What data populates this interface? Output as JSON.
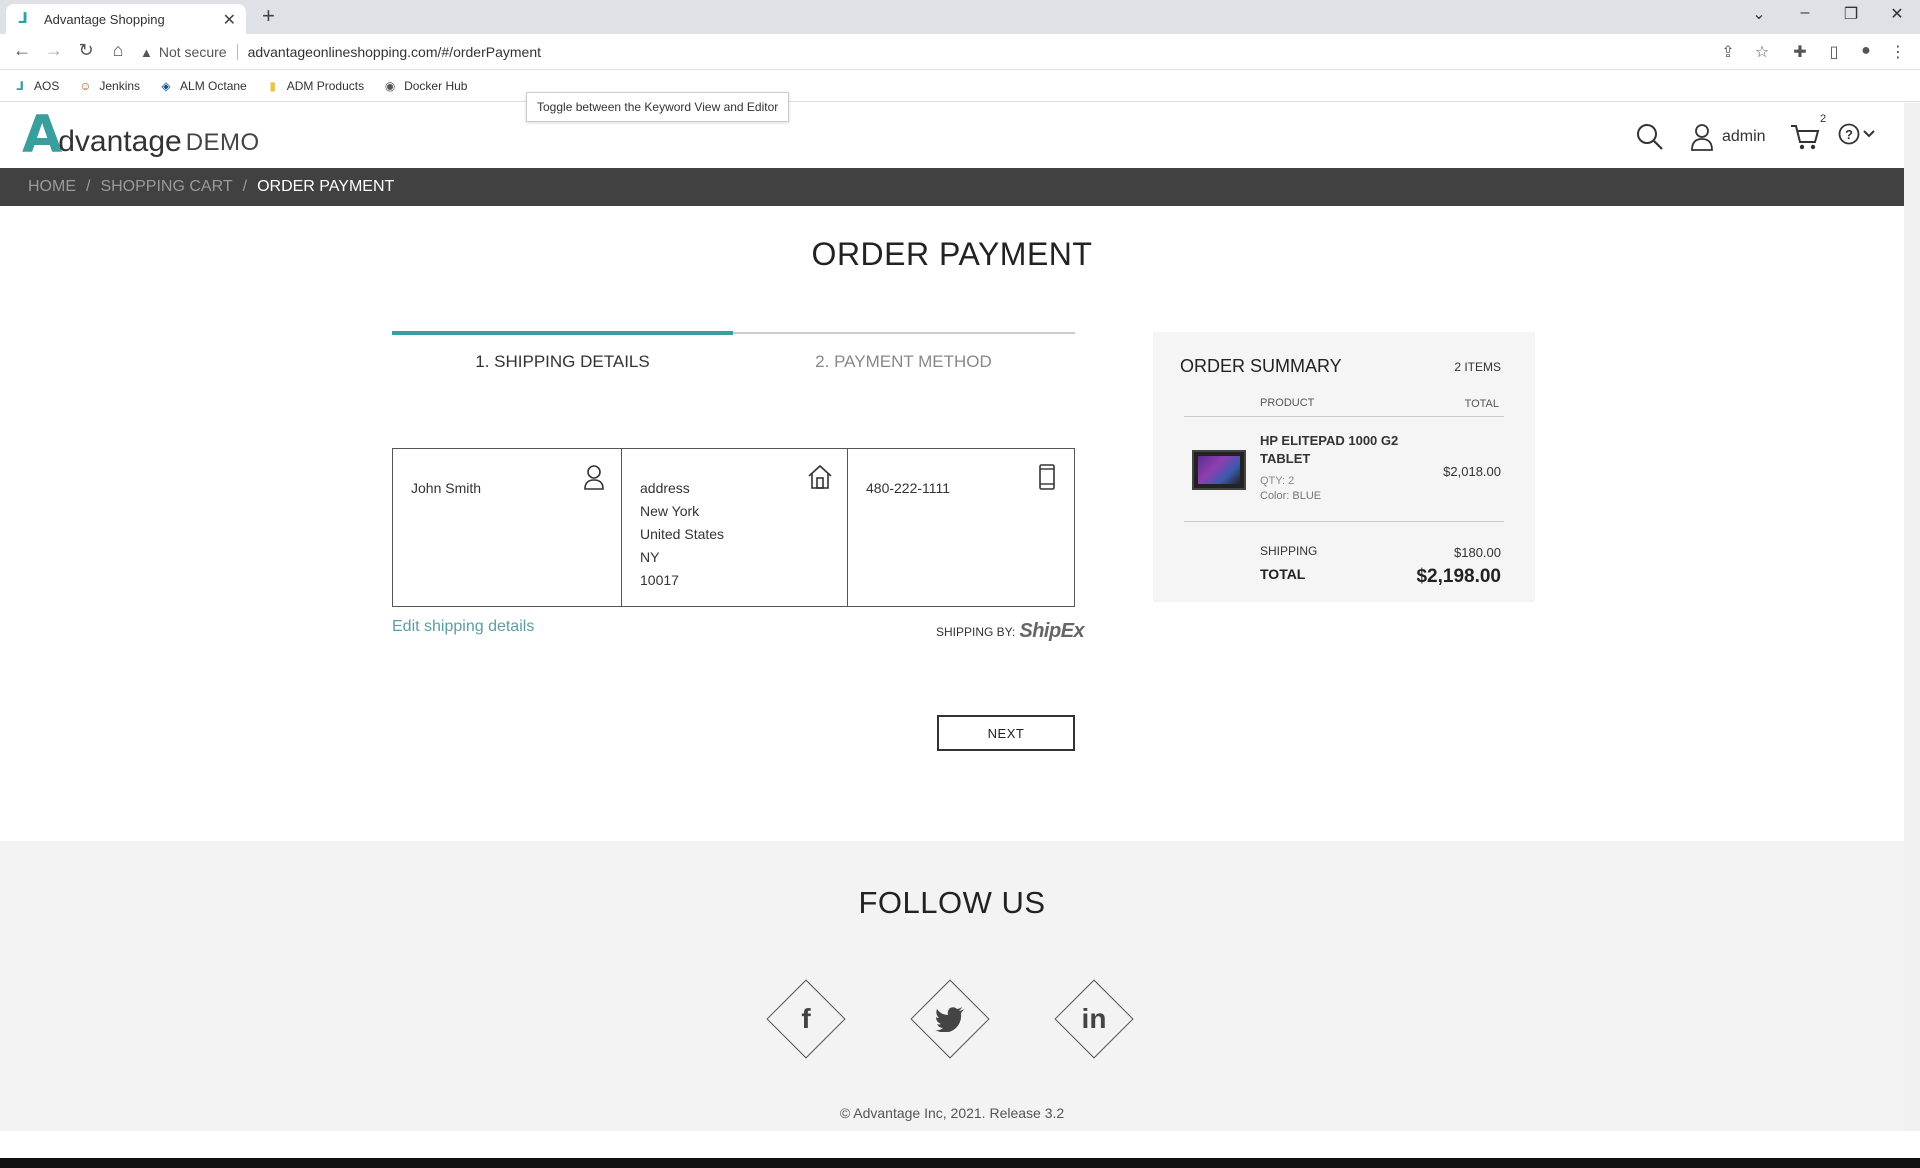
{
  "browser": {
    "tab_title": "Advantage Shopping",
    "new_tab": "+",
    "not_secure": "Not secure",
    "url": "advantageonlineshopping.com/#/orderPayment",
    "bookmarks": [
      {
        "label": "AOS"
      },
      {
        "label": "Jenkins"
      },
      {
        "label": "ALM Octane"
      },
      {
        "label": "ADM Products"
      },
      {
        "label": "Docker Hub"
      }
    ],
    "tooltip": "Toggle between the Keyword View and Editor"
  },
  "header": {
    "logo_a": "A",
    "logo_rest": "dvantage",
    "logo_demo": "DEMO",
    "username": "admin",
    "cart_count": "2"
  },
  "breadcrumb": {
    "home": "HOME",
    "cart": "SHOPPING CART",
    "current": "ORDER PAYMENT"
  },
  "main": {
    "title": "ORDER PAYMENT",
    "step1": "1. SHIPPING DETAILS",
    "step2": "2. PAYMENT METHOD",
    "shipping": {
      "name": "John Smith",
      "address": [
        "address",
        "New York",
        "United States",
        "NY",
        "10017"
      ],
      "phone": "480-222-1111"
    },
    "edit_link": "Edit shipping details",
    "shipping_by": "SHIPPING BY:",
    "shipping_brand": "ShipEx",
    "next_button": "NEXT"
  },
  "summary": {
    "title": "ORDER SUMMARY",
    "items_count": "2 ITEMS",
    "col_product": "PRODUCT",
    "col_total": "TOTAL",
    "product_name": "HP ELITEPAD 1000 G2 TABLET",
    "qty": "QTY: 2",
    "color": "Color: BLUE",
    "price": "$2,018.00",
    "shipping_label": "SHIPPING",
    "shipping_value": "$180.00",
    "total_label": "TOTAL",
    "total_value": "$2,198.00"
  },
  "footer": {
    "follow": "FOLLOW US",
    "facebook": "f",
    "linkedin": "in",
    "copyright": "© Advantage Inc, 2021. Release 3.2"
  },
  "colors": {
    "accent": "#3a9e9e",
    "link": "#5a9ea6",
    "breadcrumb_bg": "#414141"
  }
}
